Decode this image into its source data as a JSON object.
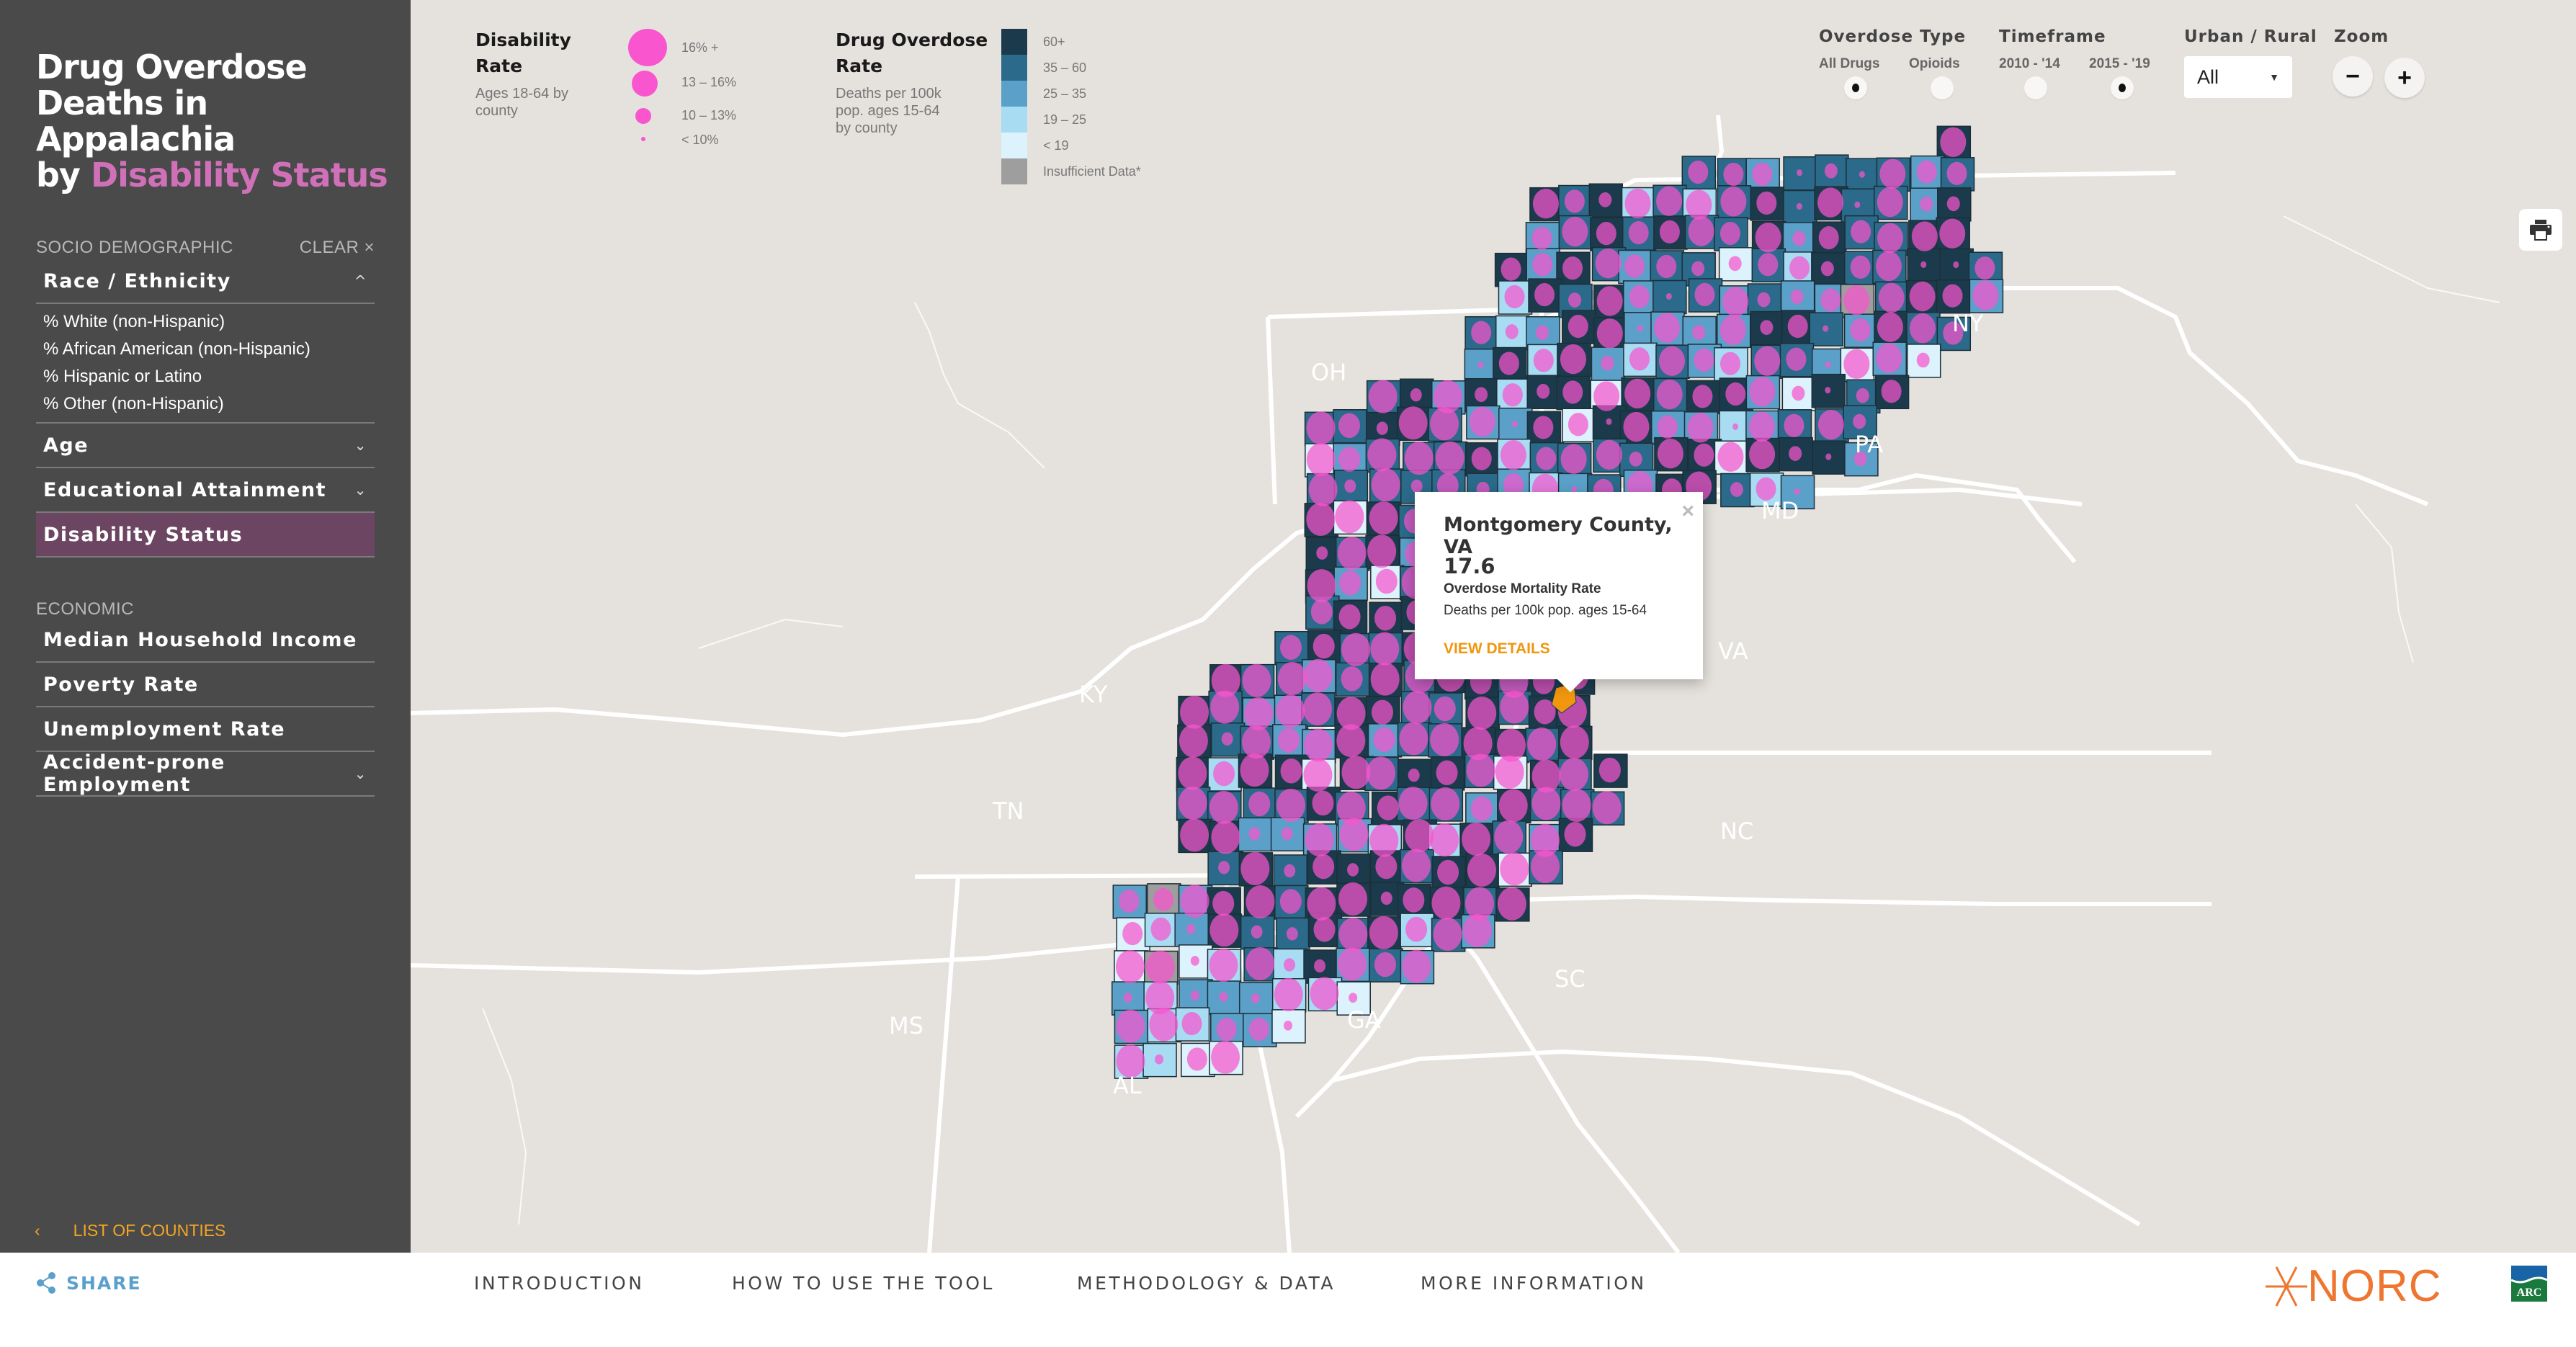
{
  "sidebar": {
    "title_line1": "Drug Overdose",
    "title_line2": "Deaths in Appalachia",
    "title_line3_prefix": "by ",
    "title_line3_accent": "Disability Status",
    "socio_heading": "SOCIO DEMOGRAPHIC",
    "clear_label": "CLEAR ×",
    "socio_items": [
      {
        "label": "Race / Ethnicity",
        "chevron": "^",
        "expanded": true
      },
      {
        "label": "Age",
        "chevron": "⌄"
      },
      {
        "label": "Educational Attainment",
        "chevron": "⌄"
      },
      {
        "label": "Disability Status",
        "active": true
      }
    ],
    "race_subitems": [
      "% White (non-Hispanic)",
      "% African American (non-Hispanic)",
      "% Hispanic or Latino",
      "% Other (non-Hispanic)"
    ],
    "economic_heading": "ECONOMIC",
    "economic_items": [
      {
        "label": "Median Household Income"
      },
      {
        "label": "Poverty Rate"
      },
      {
        "label": "Unemployment Rate"
      },
      {
        "label": "Accident-prone Employment",
        "chevron": "⌄"
      }
    ],
    "list_counties_icon": "‹",
    "list_counties_label": "LIST OF COUNTIES"
  },
  "legend": {
    "disability": {
      "title": "Disability Rate",
      "subtitle": "Ages 18-64 by county",
      "bins": [
        "16% +",
        "13 – 16%",
        "10 – 13%",
        "< 10%"
      ],
      "color": "#f855cf"
    },
    "overdose": {
      "title_line1": "Drug Overdose",
      "title_line2": "Rate",
      "subtitle": "Deaths per 100k pop. ages 15-64 by county",
      "bins": [
        {
          "label": "60+",
          "color": "#1b3b4d"
        },
        {
          "label": "35 – 60",
          "color": "#2b6a8a"
        },
        {
          "label": "25 – 35",
          "color": "#5aa0c8"
        },
        {
          "label": "19 – 25",
          "color": "#a7dcf3"
        },
        {
          "label": "< 19",
          "color": "#dcf2fc"
        },
        {
          "label": "Insufficient Data*",
          "color": "#9e9e9e"
        }
      ]
    }
  },
  "controls": {
    "overdose_type": {
      "label": "Overdose Type",
      "options": [
        "All Drugs",
        "Opioids"
      ],
      "selected": "All Drugs"
    },
    "timeframe": {
      "label": "Timeframe",
      "options": [
        "2010 - '14",
        "2015 - '19"
      ],
      "selected": "2015 - '19"
    },
    "urban_rural": {
      "label": "Urban / Rural",
      "value": "All",
      "arrow": "▼"
    },
    "zoom": {
      "label": "Zoom",
      "minus": "−",
      "plus": "+"
    }
  },
  "map": {
    "state_labels": [
      "OH",
      "NY",
      "PA",
      "MD",
      "KY",
      "VA",
      "TN",
      "NC",
      "SC",
      "GA",
      "MS",
      "AL"
    ],
    "highlight_color": "#f0960f"
  },
  "popup": {
    "county": "Montgomery County, VA",
    "value": "17.6",
    "metric": "Overdose Mortality Rate",
    "description": "Deaths per 100k pop. ages 15-64",
    "link": "VIEW DETAILS",
    "close": "×"
  },
  "footer": {
    "share_label": "SHARE",
    "nav": [
      "INTRODUCTION",
      "HOW TO USE THE TOOL",
      "METHODOLOGY & DATA",
      "MORE INFORMATION"
    ],
    "norc_label": "NORC",
    "arc_label": "ARC"
  }
}
